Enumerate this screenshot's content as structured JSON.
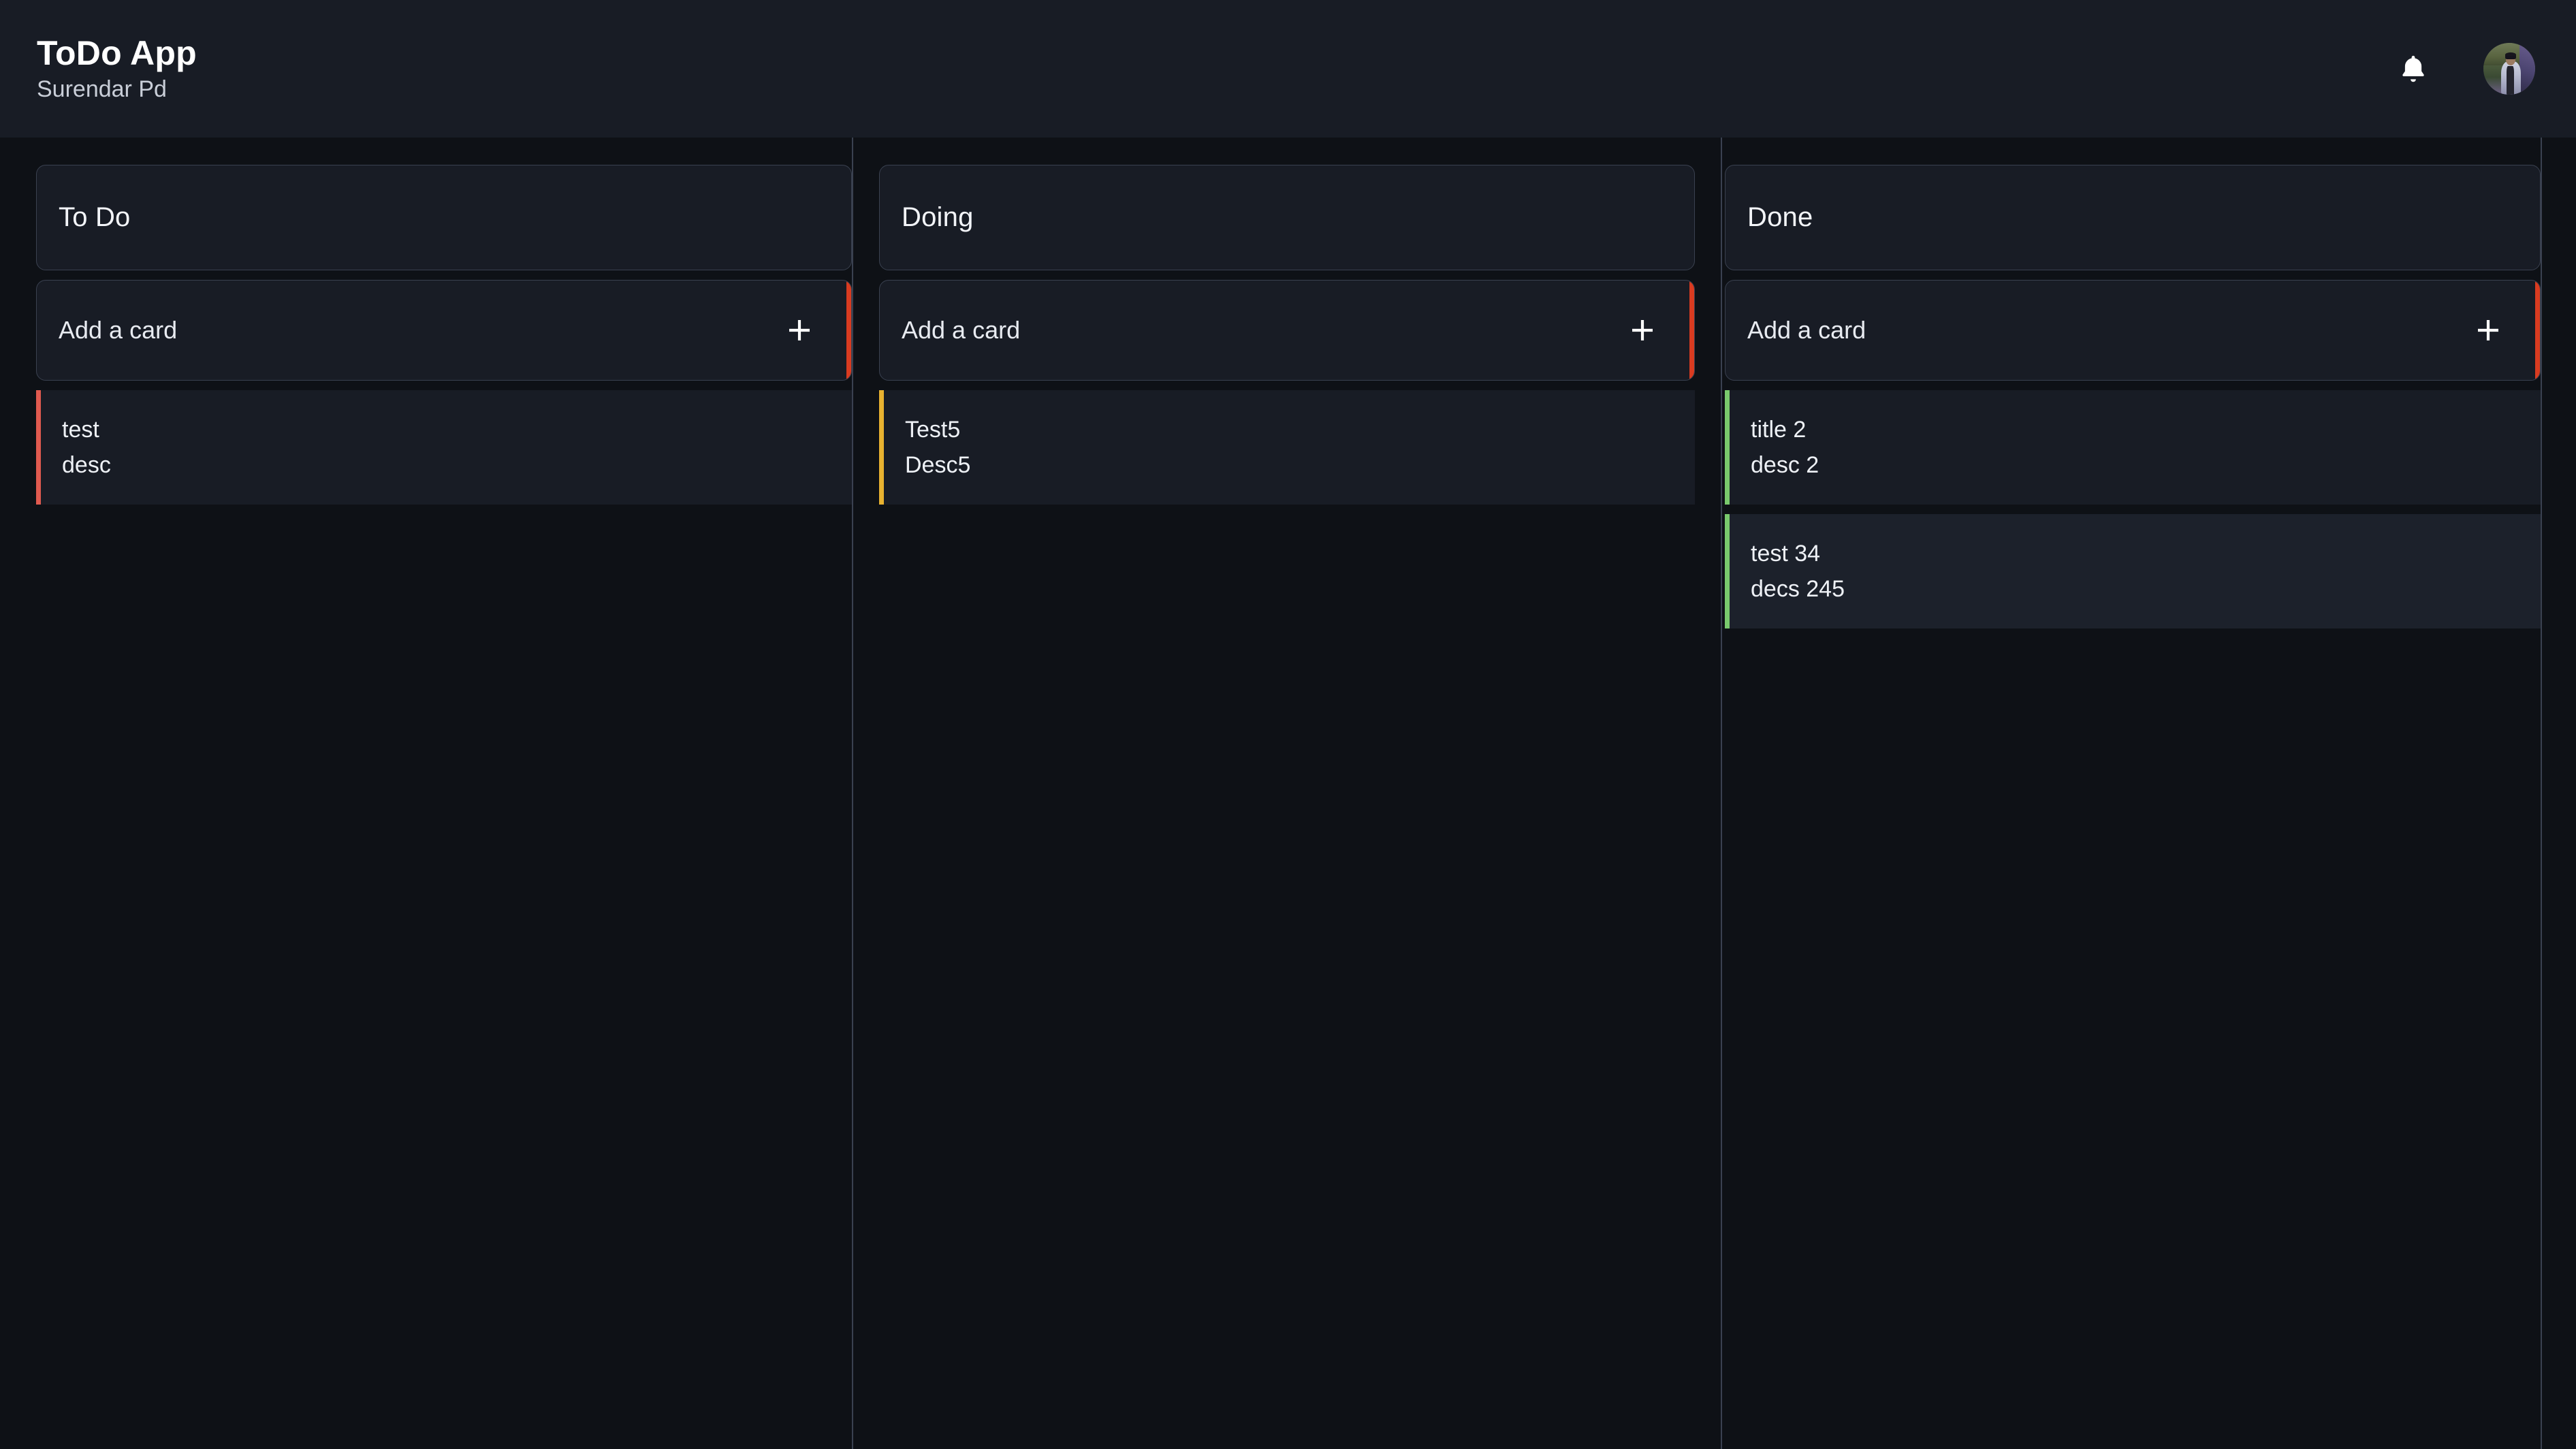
{
  "appbar": {
    "title": "ToDo App",
    "user": "Surendar Pd",
    "bell_icon": "bell-icon",
    "avatar_icon": "user-avatar"
  },
  "colors": {
    "page_bg": "#0e1116",
    "surface": "#181c25",
    "surface_raised": "#1c212b",
    "border": "#3a4150",
    "accent_red": "#d93b20",
    "card_red": "#e05a4f",
    "card_yellow": "#e8b230",
    "card_green": "#79c96d",
    "text": "#eef1f6"
  },
  "board": {
    "columns": [
      {
        "title": "To Do",
        "add_label": "Add a card",
        "add_icon": "plus-icon",
        "accent": "#d93b20",
        "cards": [
          {
            "title": "test",
            "desc": "desc",
            "accent": "#e05a4f",
            "highlight": false
          }
        ]
      },
      {
        "title": "Doing",
        "add_label": "Add a card",
        "add_icon": "plus-icon",
        "accent": "#d93b20",
        "cards": [
          {
            "title": "Test5",
            "desc": "Desc5",
            "accent": "#e8b230",
            "highlight": false
          }
        ]
      },
      {
        "title": "Done",
        "add_label": "Add a card",
        "add_icon": "plus-icon",
        "accent": "#d93b20",
        "cards": [
          {
            "title": "title 2",
            "desc": "desc 2",
            "accent": "#79c96d",
            "highlight": false
          },
          {
            "title": "test 34",
            "desc": "decs 245",
            "accent": "#79c96d",
            "highlight": true
          }
        ]
      }
    ]
  }
}
